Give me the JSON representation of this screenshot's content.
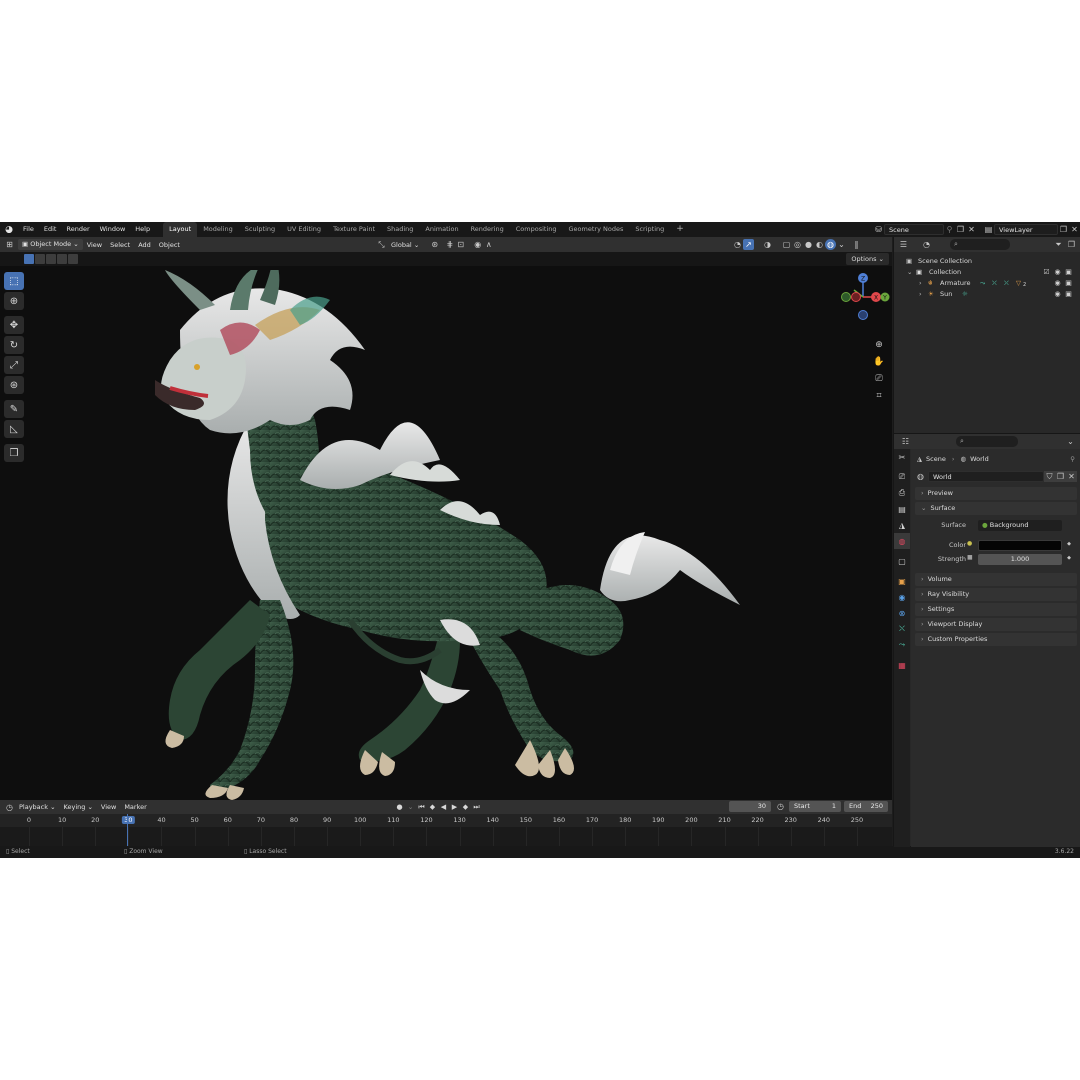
{
  "topbar": {
    "menu": [
      "File",
      "Edit",
      "Render",
      "Window",
      "Help"
    ],
    "workspaces": [
      "Layout",
      "Modeling",
      "Sculpting",
      "UV Editing",
      "Texture Paint",
      "Shading",
      "Animation",
      "Rendering",
      "Compositing",
      "Geometry Nodes",
      "Scripting"
    ],
    "active_workspace": "Layout",
    "add_workspace": "+",
    "scene": "Scene",
    "view_layer": "ViewLayer"
  },
  "viewport_header": {
    "mode": "Object Mode",
    "menu": [
      "View",
      "Select",
      "Add",
      "Object"
    ],
    "transform_orientation": "Global",
    "options": "Options"
  },
  "gizmo": {
    "z": "Z",
    "x": "X",
    "y": "Y"
  },
  "timeline": {
    "menu": [
      "Playback",
      "Keying",
      "View",
      "Marker"
    ],
    "current_frame": "30",
    "start_label": "Start",
    "start": "1",
    "end_label": "End",
    "end": "250",
    "ticks": [
      "0",
      "10",
      "20",
      "30",
      "40",
      "50",
      "60",
      "70",
      "80",
      "90",
      "100",
      "110",
      "120",
      "130",
      "140",
      "150",
      "160",
      "170",
      "180",
      "190",
      "200",
      "210",
      "220",
      "230",
      "240",
      "250"
    ],
    "current_tick": "30"
  },
  "status": {
    "select": "Select",
    "zoom": "Zoom View",
    "lasso": "Lasso Select",
    "version": "3.6.22"
  },
  "outliner": {
    "scene_collection": "Scene Collection",
    "collection": "Collection",
    "items": [
      {
        "label": "Armature",
        "badge": "2"
      },
      {
        "label": "Sun"
      }
    ]
  },
  "properties": {
    "breadcrumb": {
      "scene": "Scene",
      "world": "World"
    },
    "world_name": "World",
    "panels": {
      "preview": "Preview",
      "surface": "Surface",
      "volume": "Volume",
      "ray_visibility": "Ray Visibility",
      "settings": "Settings",
      "viewport_display": "Viewport Display",
      "custom_properties": "Custom Properties"
    },
    "surface": {
      "surface_label": "Surface",
      "surface_value": "Background",
      "color_label": "Color",
      "color_value": "#050505",
      "strength_label": "Strength",
      "strength_value": "1.000"
    }
  },
  "colors": {
    "accent": "#4772b3",
    "axis_x": "#e0484b",
    "axis_y": "#6ba53c",
    "axis_z": "#4f7fd6"
  }
}
